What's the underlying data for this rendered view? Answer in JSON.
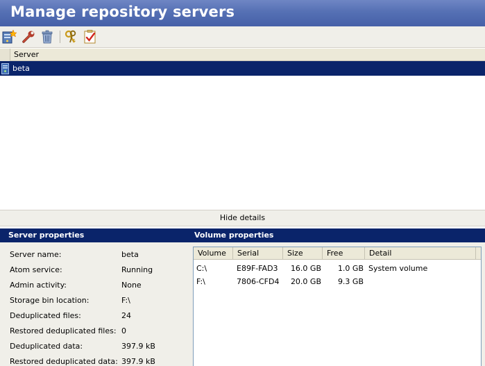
{
  "title": "Manage repository servers",
  "toolbar": {
    "icons": [
      "add-server-icon",
      "wrench-icon",
      "trash-icon",
      "keys-icon",
      "checklist-icon"
    ]
  },
  "grid": {
    "column_header": "Server",
    "rows": [
      {
        "name": "beta",
        "selected": true
      }
    ]
  },
  "hide_details_label": "Hide details",
  "server_properties": {
    "title": "Server properties",
    "items": [
      {
        "label": "Server name:",
        "value": "beta"
      },
      {
        "label": "Atom service:",
        "value": "Running"
      },
      {
        "label": "Admin activity:",
        "value": "None"
      },
      {
        "label": "Storage bin location:",
        "value": "F:\\"
      },
      {
        "label": "Deduplicated files:",
        "value": "24"
      },
      {
        "label": "Restored deduplicated files:",
        "value": "0"
      },
      {
        "label": "Deduplicated data:",
        "value": "397.9 kB"
      },
      {
        "label": "Restored deduplicated data:",
        "value": "397.9 kB"
      }
    ]
  },
  "volume_properties": {
    "title": "Volume properties",
    "columns": [
      "Volume",
      "Serial",
      "Size",
      "Free",
      "Detail"
    ],
    "rows": [
      {
        "volume": "C:\\",
        "serial": "E89F-FAD3",
        "size": "16.0 GB",
        "free": "1.0 GB",
        "detail": "System volume"
      },
      {
        "volume": "F:\\",
        "serial": "7806-CFD4",
        "size": "20.0 GB",
        "free": "9.3 GB",
        "detail": ""
      }
    ]
  },
  "colors": {
    "title_bar": "#5570b4",
    "selection": "#0a246a",
    "panel_header": "#0a246a",
    "toolbar_bg": "#f0efe9"
  }
}
